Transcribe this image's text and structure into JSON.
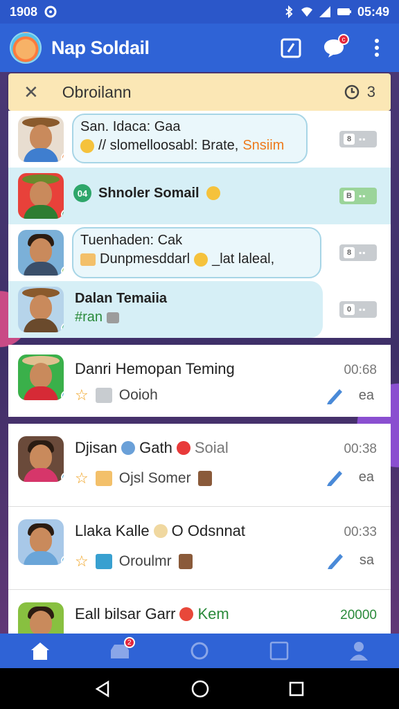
{
  "status": {
    "time": "1908",
    "clock": "05:49"
  },
  "app": {
    "title": "Nap Soldail"
  },
  "filter": {
    "title": "Obroilann",
    "count": "3"
  },
  "pinned": [
    {
      "line1": "San. Idaca: Gaa",
      "line2": "// slomelloosabl: Brate, ",
      "accent": "Snsiim",
      "badge": "8",
      "highlight": false,
      "bubble": true,
      "presence": "#f0782b",
      "shirt": "#3f7ecf",
      "bg": "#e8ddd0"
    },
    {
      "line1": "Shnoler Somail",
      "line2": "",
      "accent": "",
      "tag": "04",
      "badge": "B",
      "highlight": true,
      "bubble": false,
      "presence": "#2ea66a",
      "shirt": "#2e7d32",
      "bg": "#e8413a"
    },
    {
      "line1": "Tuenhaden: Cak",
      "line2": "Dunpmesddarl",
      "accent": "_lat laleal,",
      "badge": "8",
      "highlight": false,
      "bubble": true,
      "presence": "#7bc043",
      "shirt": "#3a4f6a",
      "bg": "#7bb0d8"
    },
    {
      "line1": "Dalan Temaiia",
      "line2": "#ran",
      "accent": "",
      "badge": "0",
      "highlight": true,
      "bubble": false,
      "presence": "#2ea66a",
      "shirt": "#6a4a2c",
      "bg": "#b6d4ea"
    }
  ],
  "chats": [
    {
      "name": "Danri Hemopan Teming",
      "sub": "Ooioh",
      "time": "00:68",
      "meta": "ea",
      "presence": "#2f9ed8",
      "shirt": "#d62a36",
      "bg": "#3ab04a"
    },
    {
      "name": "Djisan",
      "name2": "Gath",
      "name3": "Soial",
      "sub": "Ojsl Somer",
      "time": "00:38",
      "meta": "ea",
      "presence": "#2f9ed8",
      "shirt": "#d6366a",
      "bg": "#6a4a3a"
    },
    {
      "name": "Llaka Kalle",
      "name2": "O Odsnnat",
      "sub": "Oroulmr",
      "time": "00:33",
      "meta": "sa",
      "presence": "#2f9ed8",
      "shirt": "#6aa5d8",
      "bg": "#a8c8e8"
    },
    {
      "name": "Eall bilsar Garr",
      "name2": "Kem",
      "time": "20000",
      "presence": "#2f9ed8",
      "shirt": "#3a7ac0",
      "bg": "#88c040"
    }
  ],
  "nav": {
    "inbox_badge": "2"
  }
}
